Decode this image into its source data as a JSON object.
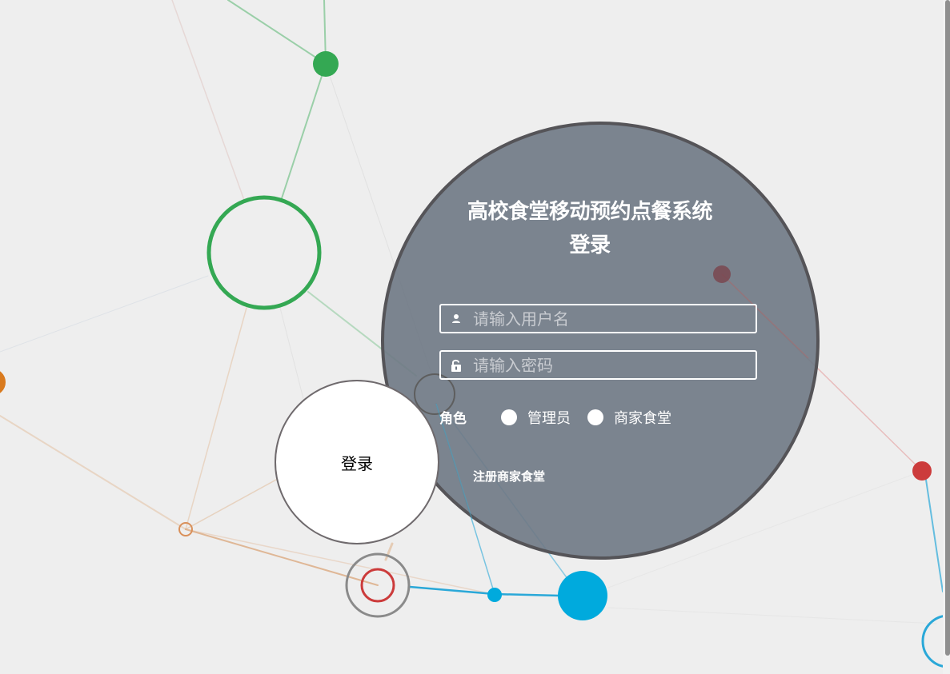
{
  "login": {
    "title": "高校食堂移动预约点餐系统登录",
    "username_placeholder": "请输入用户名",
    "password_placeholder": "请输入密码",
    "role_label": "角色",
    "roles": [
      "管理员",
      "商家食堂"
    ],
    "register_link": "注册商家食堂",
    "submit_label": "登录"
  },
  "icons": {
    "username": "user-icon",
    "password": "lock-icon"
  },
  "colors": {
    "background": "#eeeeee",
    "panel": "#6e7884",
    "panel_border": "#555458",
    "node_green": "#34a853",
    "node_blue": "#00aadd",
    "node_red": "#cc3b3b",
    "node_orange": "#d97a1e"
  }
}
